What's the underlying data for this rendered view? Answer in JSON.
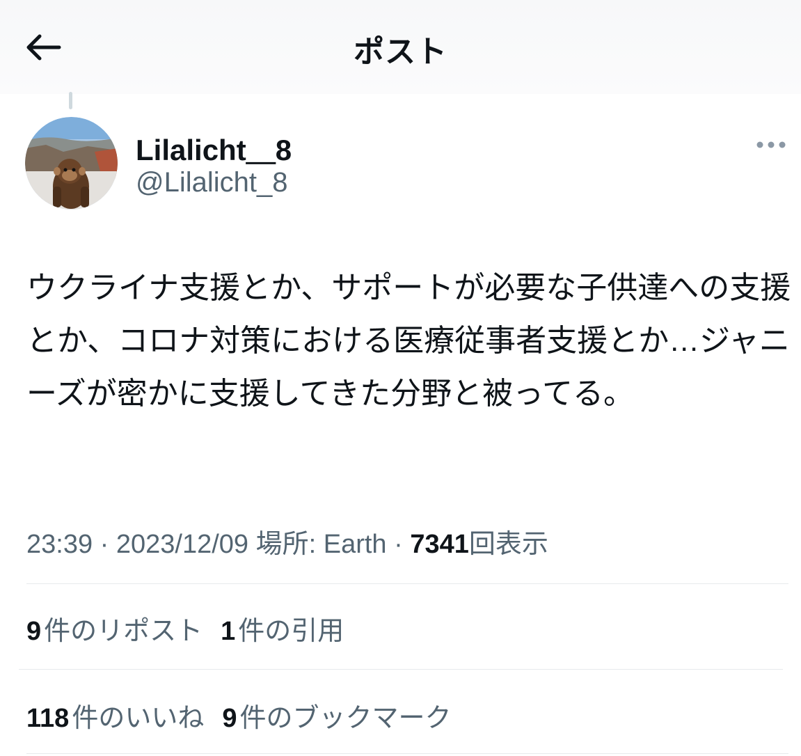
{
  "header": {
    "title": "ポスト",
    "back_icon": "arrow-left-icon"
  },
  "author": {
    "display_name": "Lilalicht＿8",
    "handle": "@Lilalicht_8",
    "avatar": "profile-photo-monkey-canyon",
    "more_icon": "more-horizontal-icon"
  },
  "post": {
    "text": "ウクライナ支援とか、サポートが必要な子供達への支援とか、コロナ対策における医療従事者支援とか…ジャニーズが密かに支援してきた分野と被ってる。"
  },
  "meta": {
    "time": "23:39",
    "sep1": " · ",
    "date": "2023/12/09",
    "location_label": " 場所: Earth",
    "sep2": " · ",
    "views_count": "7341",
    "views_label": "回表示"
  },
  "stats": {
    "reposts_count": "9",
    "reposts_label": "件のリポスト",
    "quotes_count": "1",
    "quotes_label": "件の引用",
    "likes_count": "118",
    "likes_label": "件のいいね",
    "bookmarks_count": "9",
    "bookmarks_label": "件のブックマーク"
  },
  "colors": {
    "text": "#0f1419",
    "secondary": "#536471",
    "divider": "#e7eaec"
  }
}
